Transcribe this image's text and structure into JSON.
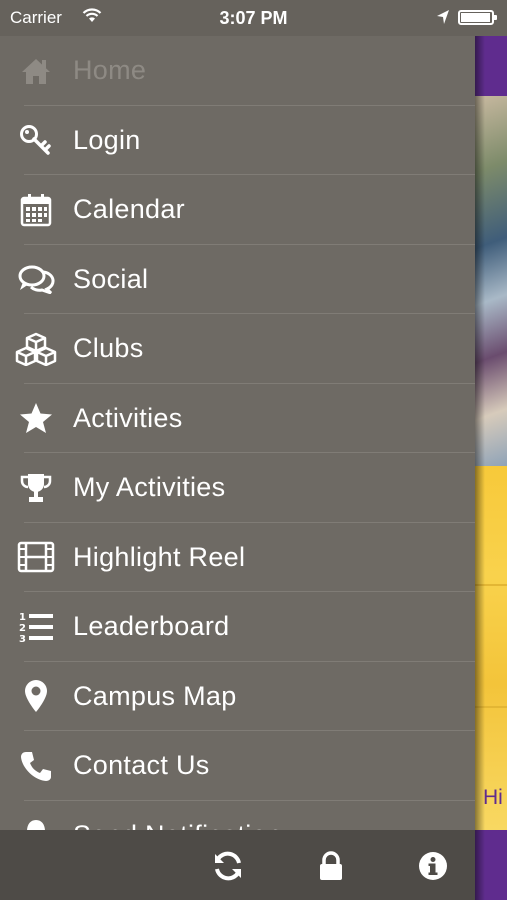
{
  "status_bar": {
    "carrier": "Carrier",
    "time": "3:07 PM",
    "battery_level": 0.95
  },
  "menu": {
    "items": [
      {
        "label": "Home",
        "icon": "home-icon"
      },
      {
        "label": "Login",
        "icon": "key-icon"
      },
      {
        "label": "Calendar",
        "icon": "calendar-icon"
      },
      {
        "label": "Social",
        "icon": "chat-bubbles-icon"
      },
      {
        "label": "Clubs",
        "icon": "cubes-icon"
      },
      {
        "label": "Activities",
        "icon": "star-icon"
      },
      {
        "label": "My Activities",
        "icon": "trophy-icon"
      },
      {
        "label": "Highlight Reel",
        "icon": "film-icon"
      },
      {
        "label": "Leaderboard",
        "icon": "numbered-list-icon"
      },
      {
        "label": "Campus Map",
        "icon": "map-marker-icon"
      },
      {
        "label": "Contact Us",
        "icon": "phone-icon"
      },
      {
        "label": "Send Notification",
        "icon": "bell-icon"
      }
    ]
  },
  "toolbar": {
    "buttons": [
      "refresh-icon",
      "lock-icon",
      "info-icon"
    ]
  },
  "background_content": {
    "partial_text": "Hi"
  },
  "colors": {
    "menu_bg": "#6e6a64",
    "toolbar_bg": "#4e4b47",
    "brand_purple": "#5f2c8e",
    "accent_yellow": "#f7c93a"
  }
}
